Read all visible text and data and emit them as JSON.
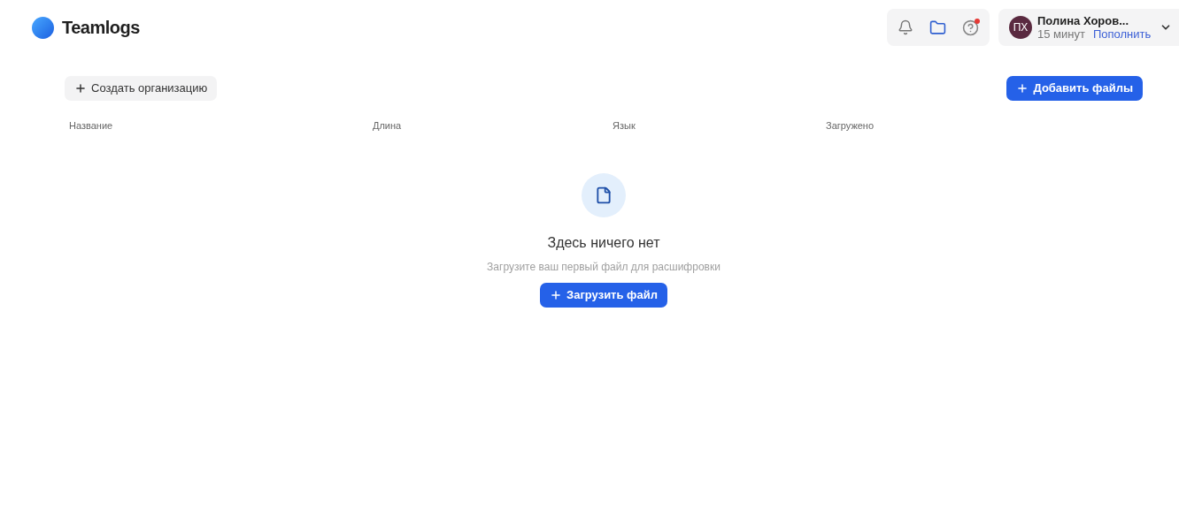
{
  "header": {
    "logo": "Teamlogs",
    "help_notification": true,
    "user": {
      "initials": "ПХ",
      "name": "Полина Хоров...",
      "balance": "15 минут",
      "top_up": "Пополнить"
    }
  },
  "toolbar": {
    "create_org": "Создать организацию",
    "add_files": "Добавить файлы"
  },
  "table": {
    "columns": [
      "Название",
      "Длина",
      "Язык",
      "Загружено"
    ]
  },
  "empty_state": {
    "title": "Здесь ничего нет",
    "subtitle": "Загрузите ваш первый файл для расшифровки",
    "button": "Загрузить файл"
  }
}
